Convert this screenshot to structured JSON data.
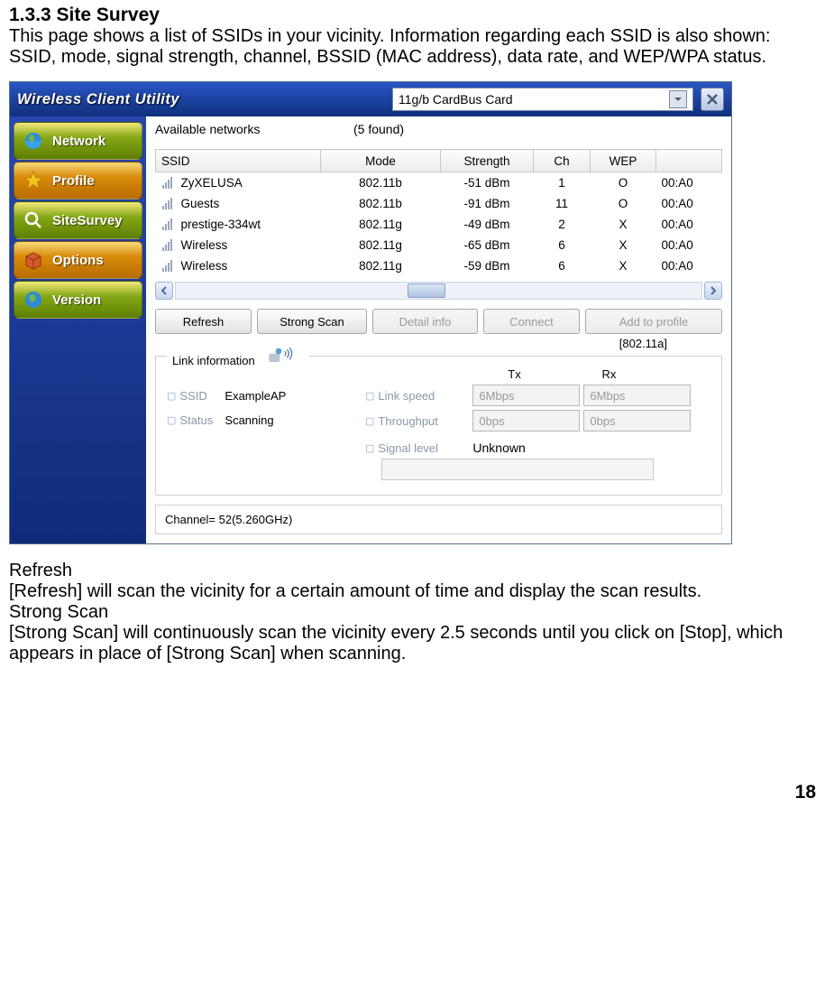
{
  "heading": "1.3.3 Site Survey",
  "intro": "This page shows a list of SSIDs in your vicinity. Information regarding each SSID is also shown: SSID, mode, signal strength, channel, BSSID (MAC address), data rate, and WEP/WPA status.",
  "app": {
    "title": "Wireless Client Utility",
    "adapter": "11g/b CardBus Card",
    "nav": {
      "network": "Network",
      "profile": "Profile",
      "sitesurvey": "SiteSurvey",
      "options": "Options",
      "version": "Version"
    },
    "available_label": "Available networks",
    "found_count": "(5 found)",
    "columns": {
      "ssid": "SSID",
      "mode": "Mode",
      "strength": "Strength",
      "ch": "Ch",
      "wep": "WEP",
      "bssid": ""
    },
    "networks": [
      {
        "ssid": "ZyXELUSA",
        "mode": "802.11b",
        "strength": "-51 dBm",
        "ch": "1",
        "wep": "O",
        "bssid": "00:A0"
      },
      {
        "ssid": "Guests",
        "mode": "802.11b",
        "strength": "-91 dBm",
        "ch": "11",
        "wep": "O",
        "bssid": "00:A0"
      },
      {
        "ssid": "prestige-334wt",
        "mode": "802.11g",
        "strength": "-49 dBm",
        "ch": "2",
        "wep": "X",
        "bssid": "00:A0"
      },
      {
        "ssid": "Wireless",
        "mode": "802.11g",
        "strength": "-65 dBm",
        "ch": "6",
        "wep": "X",
        "bssid": "00:A0"
      },
      {
        "ssid": "Wireless",
        "mode": "802.11g",
        "strength": "-59 dBm",
        "ch": "6",
        "wep": "X",
        "bssid": "00:A0"
      }
    ],
    "actions": {
      "refresh": "Refresh",
      "strong_scan": "Strong Scan",
      "detail": "Detail info",
      "connect": "Connect",
      "add_profile": "Add to profile"
    },
    "link": {
      "legend": "Link information",
      "mode_tag": "[802.11a]",
      "ssid_label": "SSID",
      "ssid_value": "ExampleAP",
      "status_label": "Status",
      "status_value": "Scanning",
      "linkspeed_label": "Link speed",
      "throughput_label": "Throughput",
      "signal_label": "Signal level",
      "signal_value": "Unknown",
      "tx_label": "Tx",
      "rx_label": "Rx",
      "linkspeed_tx": "6Mbps",
      "linkspeed_rx": "6Mbps",
      "throughput_tx": "0bps",
      "throughput_rx": "0bps"
    },
    "channel": "Channel= 52(5.260GHz)"
  },
  "descriptions": {
    "refresh_title": "Refresh",
    "refresh_body": "[Refresh] will scan the vicinity for a certain amount of time and display the scan results.",
    "strong_title": "Strong Scan",
    "strong_body": "[Strong Scan] will continuously scan the vicinity every 2.5 seconds until you click on [Stop], which appears in place of [Strong Scan] when scanning."
  },
  "page_number": "18"
}
